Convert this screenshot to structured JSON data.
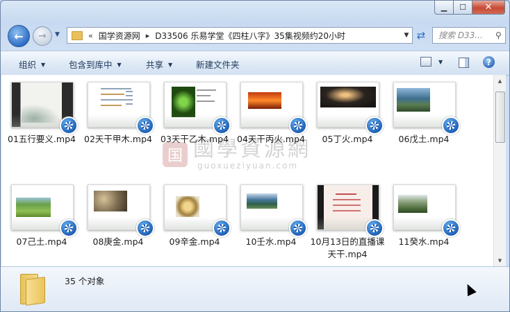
{
  "window": {
    "caption_buttons": {
      "minimize": "▁",
      "maximize": "☐",
      "close": "✕"
    }
  },
  "nav": {
    "back_glyph": "←",
    "forward_glyph": "→",
    "recent_glyph": "▼",
    "breadcrumb_overflow": "«",
    "breadcrumb_sep": "▸",
    "breadcrumbs": [
      "国学资源网",
      "D33506 乐易学堂《四柱八字》35集视频约20小时"
    ],
    "address_dropdown": "▼",
    "refresh_glyph": "⇄",
    "search_placeholder": "搜索 D33...",
    "search_glyph": "⚲"
  },
  "toolbar": {
    "organize": "组织",
    "include_in_library": "包含到库中",
    "share": "共享",
    "new_folder": "新建文件夹",
    "dropdown_glyph": "▼",
    "help_glyph": "?"
  },
  "files": [
    {
      "name": "01五行要义.mp4",
      "thumb": "ink"
    },
    {
      "name": "02天干甲木.mp4",
      "thumb": "text"
    },
    {
      "name": "03天干乙木.mp4",
      "thumb": "green"
    },
    {
      "name": "04天干丙火.mp4",
      "thumb": "sun"
    },
    {
      "name": "05丁火.mp4",
      "thumb": "dark"
    },
    {
      "name": "06戊土.mp4",
      "thumb": "mountain"
    },
    {
      "name": "07己土.mp4",
      "thumb": "field"
    },
    {
      "name": "08庚金.mp4",
      "thumb": "coins"
    },
    {
      "name": "09辛金.mp4",
      "thumb": "jewelry"
    },
    {
      "name": "10壬水.mp4",
      "thumb": "river"
    },
    {
      "name": "10月13日的直播课天干.mp4",
      "thumb": "slide"
    },
    {
      "name": "11癸水.mp4",
      "thumb": "valley"
    }
  ],
  "watermark": {
    "seal": "国",
    "text": "國學資源網",
    "url": "guoxueziyuan.com"
  },
  "status": {
    "count": "35 个对象"
  }
}
